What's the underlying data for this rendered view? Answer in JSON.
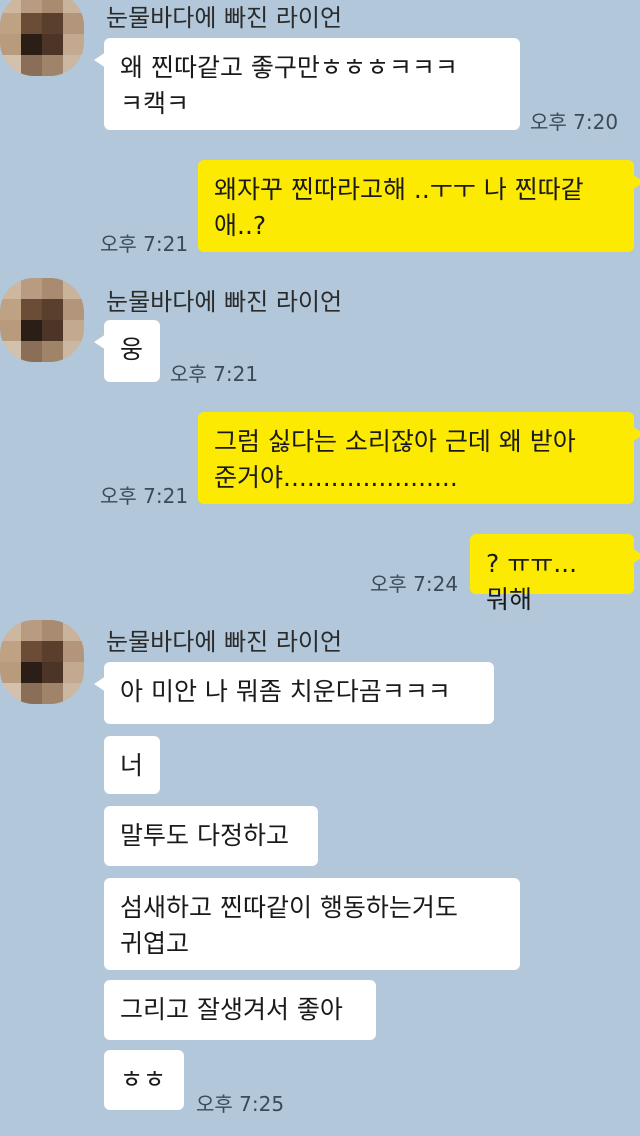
{
  "colors": {
    "background": "#b2c7da",
    "incoming_bubble": "#ffffff",
    "outgoing_bubble": "#fdea02"
  },
  "sender_name": "눈물바다에 빠진 라이언",
  "messages": [
    {
      "from": "them",
      "text": "왜 찐따같고 좋구만ㅎㅎㅎㅋㅋㅋ\nㅋ캑ㅋ",
      "time": "오후 7:20"
    },
    {
      "from": "me",
      "text": "왜자꾸 찐따라고해 ..ㅜㅜ 나 찐따같\n애..?",
      "time": "오후 7:21"
    },
    {
      "from": "them",
      "text": "웅",
      "time": "오후 7:21"
    },
    {
      "from": "me",
      "text": "그럼 싫다는 소리잖아 근데 왜 받아\n준거야......................",
      "time": "오후 7:21"
    },
    {
      "from": "me",
      "text": "? ㅠㅠ... 뭐해",
      "time": "오후 7:24"
    },
    {
      "from": "them",
      "text": "아 미안 나 뭐좀 치운다곰ㅋㅋㅋ"
    },
    {
      "from": "them",
      "text": "너"
    },
    {
      "from": "them",
      "text": "말투도 다정하고"
    },
    {
      "from": "them",
      "text": "섬새하고 찐따같이 행동하는거도\n귀엽고"
    },
    {
      "from": "them",
      "text": "그리고 잘생겨서 좋아"
    },
    {
      "from": "them",
      "text": "ㅎㅎ",
      "time": "오후 7:25"
    }
  ],
  "avatar_icon": "pixelated-profile-photo"
}
